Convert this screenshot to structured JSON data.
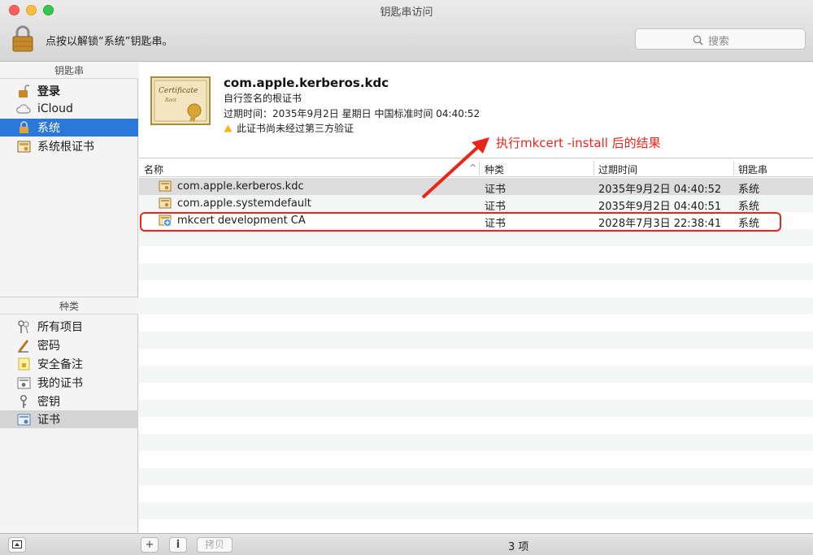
{
  "window": {
    "title": "钥匙串访问"
  },
  "toolbar": {
    "lock_text": "点按以解锁“系统”钥匙串。",
    "search_placeholder": "搜索"
  },
  "sidebar": {
    "keychains_header": "钥匙串",
    "keychains": [
      {
        "label": "登录",
        "icon": "lock-open-icon",
        "bold": true
      },
      {
        "label": "iCloud",
        "icon": "cloud-icon"
      },
      {
        "label": "系统",
        "icon": "lock-icon",
        "selected": true
      },
      {
        "label": "系统根证书",
        "icon": "certificate-folder-icon"
      }
    ],
    "category_header": "种类",
    "categories": [
      {
        "label": "所有项目",
        "icon": "keys-icon"
      },
      {
        "label": "密码",
        "icon": "pencil-icon"
      },
      {
        "label": "安全备注",
        "icon": "note-icon"
      },
      {
        "label": "我的证书",
        "icon": "my-certificate-icon"
      },
      {
        "label": "密钥",
        "icon": "key-icon"
      },
      {
        "label": "证书",
        "icon": "certificate-icon",
        "selected": true
      }
    ]
  },
  "detail": {
    "title": "com.apple.kerberos.kdc",
    "subtitle": "自行签名的根证书",
    "expires": "过期时间：2035年9月2日 星期日 中国标准时间 04:40:52",
    "warning": "此证书尚未经过第三方验证",
    "cert_image_text": "Certificate",
    "cert_image_sub": "Root"
  },
  "annotation": "执行mkcert -install 后的结果",
  "table": {
    "headers": {
      "name": "名称",
      "kind": "种类",
      "expires": "过期时间",
      "keychain": "钥匙串"
    },
    "rows": [
      {
        "name": "com.apple.kerberos.kdc",
        "kind": "证书",
        "expires": "2035年9月2日 04:40:52",
        "keychain": "系统"
      },
      {
        "name": "com.apple.systemdefault",
        "kind": "证书",
        "expires": "2035年9月2日 04:40:51",
        "keychain": "系统"
      },
      {
        "name": "mkcert development CA",
        "kind": "证书",
        "expires": "2028年7月3日 22:38:41",
        "keychain": "系统"
      }
    ]
  },
  "bottom": {
    "add": "+",
    "info": "i",
    "copy": "拷贝",
    "count": "3 项"
  },
  "colors": {
    "accent": "#2a79da",
    "annotation": "#e8261b"
  }
}
